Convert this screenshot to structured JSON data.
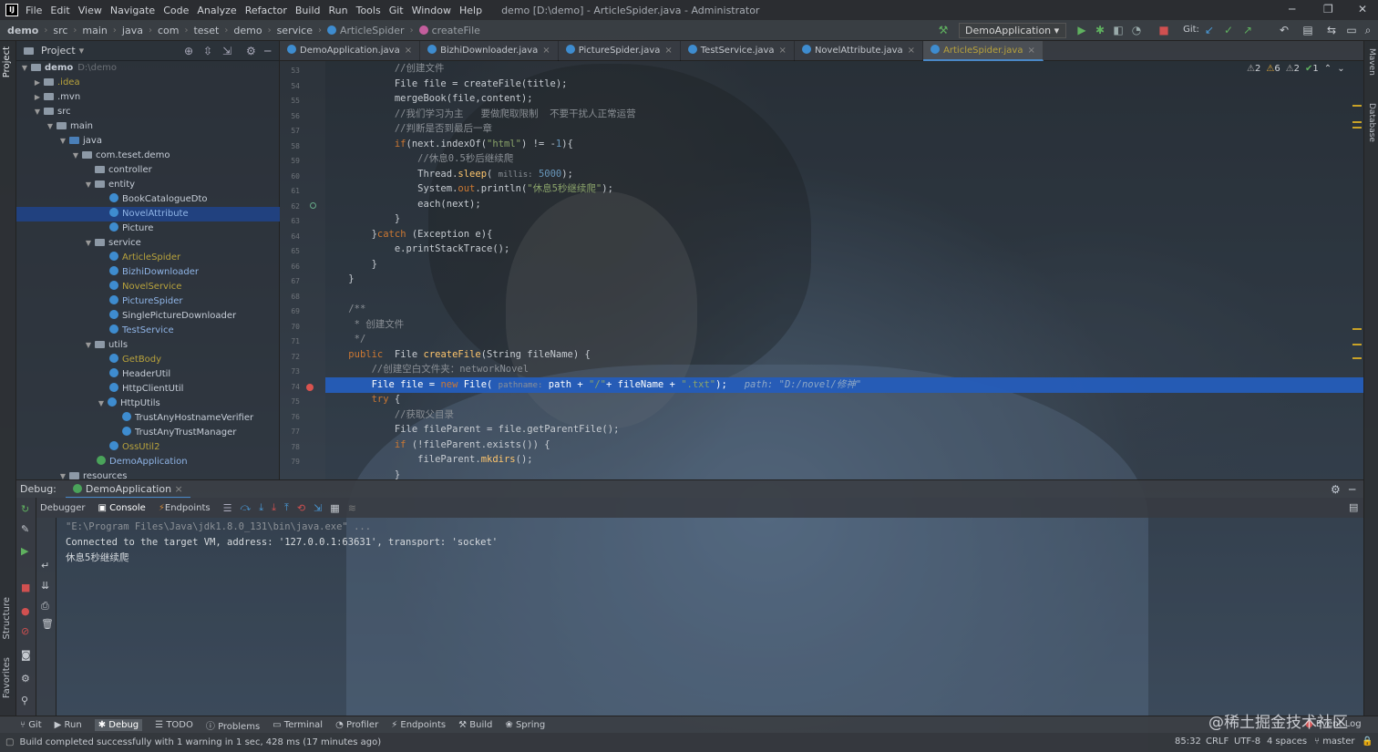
{
  "app": {
    "window_title": "demo [D:\\demo] - ArticleSpider.java - Administrator"
  },
  "menu": [
    "File",
    "Edit",
    "View",
    "Navigate",
    "Code",
    "Analyze",
    "Refactor",
    "Build",
    "Run",
    "Tools",
    "Git",
    "Window",
    "Help"
  ],
  "breadcrumb": [
    "demo",
    "src",
    "main",
    "java",
    "com",
    "teset",
    "demo",
    "service",
    "ArticleSpider",
    "createFile"
  ],
  "run_config": "DemoApplication",
  "git_label": "Git:",
  "project_panel": {
    "title": "Project",
    "tree": [
      {
        "label": "demo",
        "hint": "D:\\demo",
        "type": "folder"
      },
      {
        "label": ".idea",
        "type": "folder"
      },
      {
        "label": ".mvn",
        "type": "folder"
      },
      {
        "label": "src",
        "type": "folder"
      },
      {
        "label": "main",
        "type": "folder"
      },
      {
        "label": "java",
        "type": "folder"
      },
      {
        "label": "com.teset.demo",
        "type": "folder"
      },
      {
        "label": "controller",
        "type": "folder"
      },
      {
        "label": "entity",
        "type": "folder"
      },
      {
        "label": "BookCatalogueDto",
        "type": "class"
      },
      {
        "label": "NovelAttribute",
        "type": "class",
        "selected": true
      },
      {
        "label": "Picture",
        "type": "class"
      },
      {
        "label": "service",
        "type": "folder"
      },
      {
        "label": "ArticleSpider",
        "type": "class"
      },
      {
        "label": "BizhiDownloader",
        "type": "class"
      },
      {
        "label": "NovelService",
        "type": "class"
      },
      {
        "label": "PictureSpider",
        "type": "class"
      },
      {
        "label": "SinglePictureDownloader",
        "type": "class"
      },
      {
        "label": "TestService",
        "type": "class"
      },
      {
        "label": "utils",
        "type": "folder"
      },
      {
        "label": "GetBody",
        "type": "class"
      },
      {
        "label": "HeaderUtil",
        "type": "class"
      },
      {
        "label": "HttpClientUtil",
        "type": "class"
      },
      {
        "label": "HttpUtils",
        "type": "class"
      },
      {
        "label": "TrustAnyHostnameVerifier",
        "type": "class"
      },
      {
        "label": "TrustAnyTrustManager",
        "type": "class"
      },
      {
        "label": "OssUtil2",
        "type": "class"
      },
      {
        "label": "DemoApplication",
        "type": "spring"
      },
      {
        "label": "resources",
        "type": "folder"
      }
    ]
  },
  "editor_tabs": [
    "DemoApplication.java",
    "BizhiDownloader.java",
    "PictureSpider.java",
    "TestService.java",
    "NovelAttribute.java",
    "ArticleSpider.java"
  ],
  "inspections": [
    "2",
    "6",
    "2",
    "1"
  ],
  "line_numbers": [
    "53",
    "54",
    "55",
    "56",
    "57",
    "58",
    "59",
    "60",
    "61",
    "62",
    "63",
    "64",
    "65",
    "66",
    "67",
    "68",
    "69",
    "70",
    "71",
    "72",
    "73",
    "74",
    "75",
    "76",
    "77",
    "78",
    "79"
  ],
  "debug": {
    "title": "Debug:",
    "config": "DemoApplication",
    "tabs": [
      "Debugger",
      "Console",
      "Endpoints"
    ],
    "console": [
      "\"E:\\Program Files\\Java\\jdk1.8.0_131\\bin\\java.exe\" ...",
      "Connected to the target VM, address: '127.0.0.1:63631', transport: 'socket'",
      "休息5秒继续爬"
    ]
  },
  "tool_windows": [
    "Git",
    "Run",
    "Debug",
    "TODO",
    "Problems",
    "Terminal",
    "Profiler",
    "Endpoints",
    "Build",
    "Spring"
  ],
  "side_labels": {
    "project": "Project",
    "structure": "Structure",
    "favorites": "Favorites",
    "maven": "Maven",
    "database": "Database"
  },
  "status": {
    "message": "Build completed successfully with 1 warning in 1 sec, 428 ms (17 minutes ago)",
    "position": "85:32",
    "line_sep": "CRLF",
    "encoding": "UTF-8",
    "indent": "4 spaces",
    "branch": "master",
    "event_log": "Event Log"
  },
  "watermark": "@稀土掘金技术社区"
}
